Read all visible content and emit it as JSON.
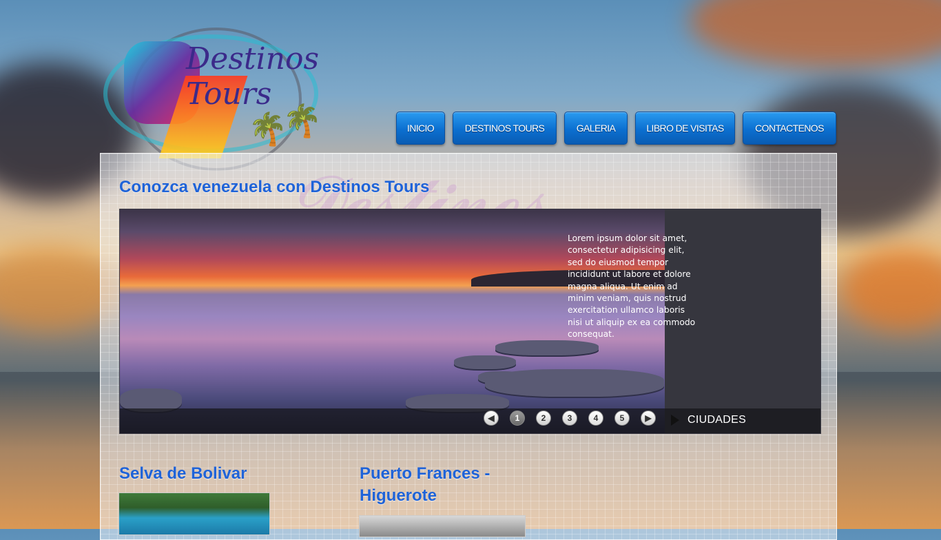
{
  "logo": {
    "text": "Destinos Tours",
    "icon": "palm-tree-icon"
  },
  "nav": {
    "items": [
      {
        "label": "INICIO"
      },
      {
        "label": "DESTINOS TOURS"
      },
      {
        "label": "GALERIA"
      },
      {
        "label": "LIBRO DE VISITAS"
      },
      {
        "label": "CONTACTENOS"
      }
    ]
  },
  "main": {
    "heading": "Conozca venezuela con Destinos Tours",
    "slider": {
      "caption": "Lorem ipsum dolor sit amet, consectetur adipisicing elit, sed do eiusmod tempor incididunt ut labore et dolore magna aliqua. Ut enim ad minim veniam, quis nostrud exercitation ullamco laboris nisi ut aliquip ex ea commodo consequat.",
      "prev_icon": "chevron-left-icon",
      "next_icon": "chevron-right-icon",
      "pages": [
        "1",
        "2",
        "3",
        "4",
        "5"
      ],
      "active_page": "1",
      "category_label": "CIUDADES"
    },
    "sections": [
      {
        "title": "Selva de Bolivar"
      },
      {
        "title": "Puerto Frances - Higuerote"
      }
    ]
  },
  "colors": {
    "nav_blue": "#0b6fd0",
    "heading_blue": "#1f63d8"
  }
}
